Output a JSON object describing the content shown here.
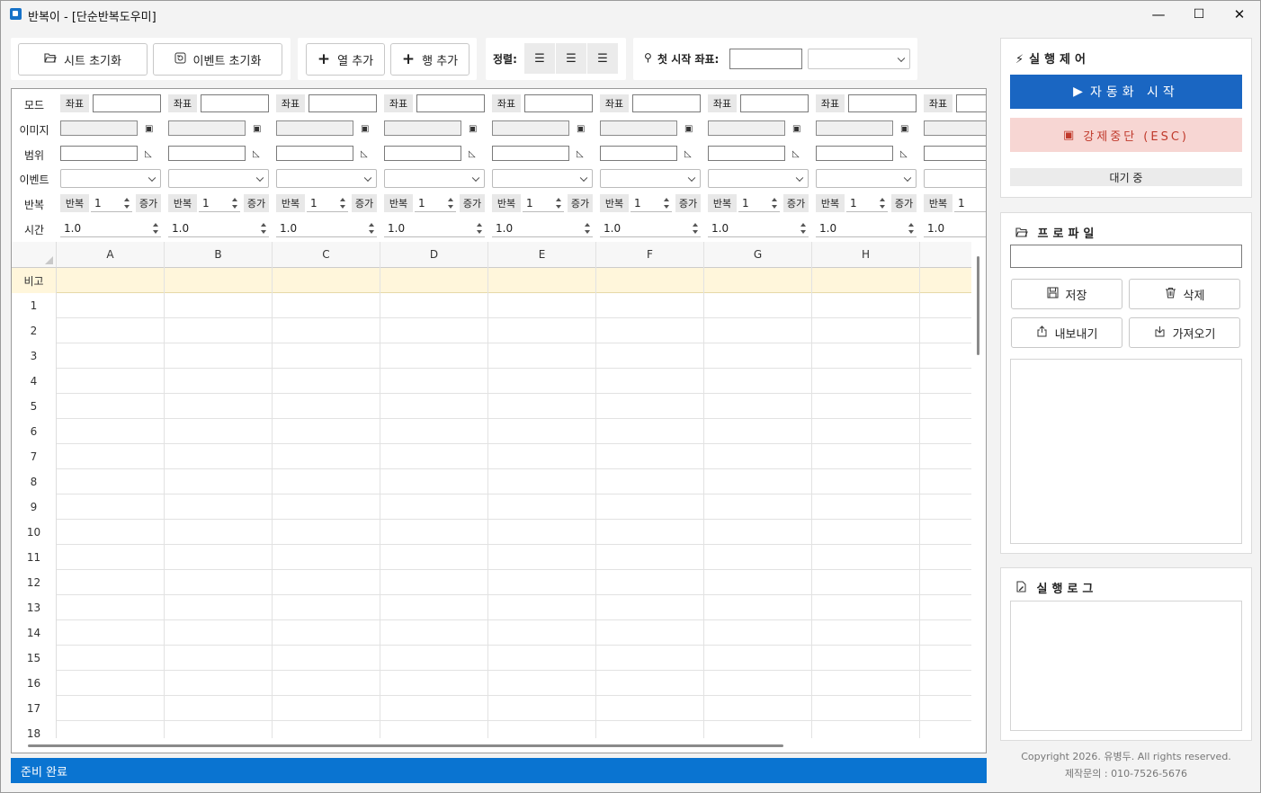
{
  "window": {
    "title": "반복이 - [단순반복도우미]",
    "minimize": "—",
    "maximize": "☐",
    "close": "✕"
  },
  "toolbar": {
    "reset_sheet": "시트 초기화",
    "reset_event": "이벤트 초기화",
    "add_column": "열 추가",
    "add_row": "행 추가",
    "align_label": "정렬:",
    "start_coord_label": "첫 시작 좌표:",
    "start_coord_value": "",
    "start_mode_value": ""
  },
  "config": {
    "row_labels": [
      "모드",
      "이미지",
      "범위",
      "이벤트",
      "반복",
      "시간"
    ],
    "coord_label": "좌표",
    "repeat_label": "반복",
    "repeat_value": "1",
    "increment_label": "증가",
    "time_value": "1.0"
  },
  "grid": {
    "columns": [
      "A",
      "B",
      "C",
      "D",
      "E",
      "F",
      "G",
      "H",
      ""
    ],
    "note_row_label": "비고",
    "rows": [
      "1",
      "2",
      "3",
      "4",
      "5",
      "6",
      "7",
      "8",
      "9",
      "10",
      "11",
      "12",
      "13",
      "14",
      "15",
      "16",
      "17",
      "18"
    ]
  },
  "status": "준비 완료",
  "run_control": {
    "title": "실행제어",
    "start": "자동화 시작",
    "stop": "강제중단 (ESC)",
    "state": "대기 중"
  },
  "profile": {
    "title": "프로파일",
    "name_value": "",
    "save": "저장",
    "delete": "삭제",
    "export": "내보내기",
    "import": "가져오기"
  },
  "log": {
    "title": "실행로그"
  },
  "footer": {
    "copyright": "Copyright 2026. 유병두. All rights reserved.",
    "contact": "제작문의 : 010-7526-5676"
  },
  "colors": {
    "accent": "#1a66c2",
    "status_bar": "#0a74d1",
    "danger_bg": "#f7d6d3",
    "danger_text": "#c0392b",
    "note_row": "#fff6db"
  }
}
